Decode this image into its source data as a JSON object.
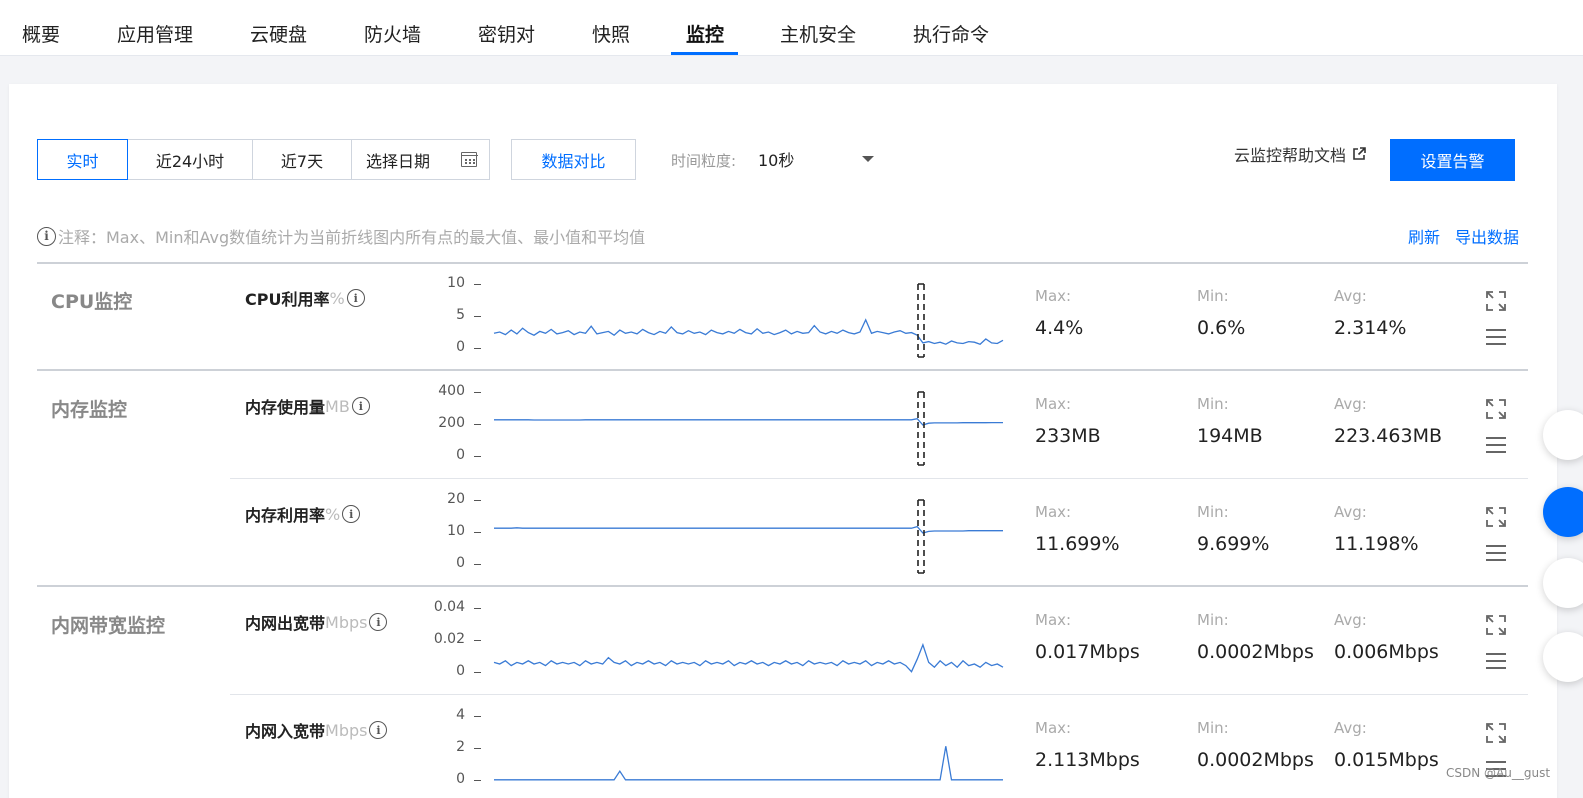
{
  "tabs": [
    {
      "label": "概要",
      "name": "tab-overview",
      "active": false
    },
    {
      "label": "应用管理",
      "name": "tab-app-management",
      "active": false
    },
    {
      "label": "云硬盘",
      "name": "tab-cloud-disk",
      "active": false
    },
    {
      "label": "防火墙",
      "name": "tab-firewall",
      "active": false
    },
    {
      "label": "密钥对",
      "name": "tab-keypair",
      "active": false
    },
    {
      "label": "快照",
      "name": "tab-snapshot",
      "active": false
    },
    {
      "label": "监控",
      "name": "tab-monitoring",
      "active": true
    },
    {
      "label": "主机安全",
      "name": "tab-host-security",
      "active": false
    },
    {
      "label": "执行命令",
      "name": "tab-run-command",
      "active": false
    }
  ],
  "toolbar": {
    "ranges": [
      "实时",
      "近24小时",
      "近7天"
    ],
    "active_range": "实时",
    "date_placeholder": "选择日期",
    "compare_label": "数据对比",
    "granularity_label": "时间粒度:",
    "granularity_value": "10秒",
    "help_label": "云监控帮助文档",
    "alarm_label": "设置告警"
  },
  "note": {
    "text": "注释：Max、Min和Avg数值统计为当前折线图内所有点的最大值、最小值和平均值",
    "refresh_label": "刷新",
    "export_label": "导出数据"
  },
  "stat_labels": {
    "max": "Max:",
    "min": "Min:",
    "avg": "Avg:"
  },
  "groups": [
    {
      "title": "CPU监控"
    },
    {
      "title": "内存监控"
    },
    {
      "title": "内网带宽监控"
    }
  ],
  "chart_data": [
    {
      "type": "line",
      "title": "CPU利用率",
      "unit": "%",
      "yticks": [
        "10",
        "5",
        "0"
      ],
      "ylim": [
        0,
        10
      ],
      "series": [
        {
          "values": [
            2.3,
            2.5,
            2.1,
            2.8,
            2.2,
            3.1,
            2.4,
            2.0,
            2.6,
            2.3,
            2.9,
            2.2,
            2.4,
            2.7,
            2.1,
            2.5,
            2.3,
            3.4,
            2.2,
            2.4,
            2.6,
            2.0,
            2.8,
            2.3,
            2.5,
            2.2,
            2.9,
            2.4,
            2.1,
            2.6,
            2.3,
            3.3,
            2.4,
            2.2,
            2.7,
            2.3,
            2.5,
            2.1,
            2.8,
            2.4,
            2.2,
            2.6,
            2.3,
            2.9,
            2.4,
            2.2,
            3.0,
            2.3,
            2.5,
            2.1,
            2.4,
            2.8,
            2.2,
            2.6,
            2.3,
            2.4,
            3.5,
            2.5,
            2.2,
            2.6,
            2.3,
            2.8,
            2.4,
            2.2,
            2.5,
            4.4,
            2.3,
            2.6,
            2.4,
            2.2,
            2.5,
            2.7,
            2.3,
            2.4,
            2.0,
            0.8,
            1.0,
            0.7,
            0.9,
            0.6,
            1.1,
            0.8,
            0.7,
            1.0,
            0.9,
            0.6,
            1.4,
            0.8,
            0.7,
            1.2
          ]
        }
      ]
    },
    {
      "type": "line",
      "title": "内存使用量",
      "unit": "MB",
      "yticks": [
        "400",
        "200",
        "0"
      ],
      "ylim": [
        0,
        400
      ],
      "series": [
        {
          "values": [
            226,
            226,
            226,
            226,
            226,
            226,
            226,
            225,
            225,
            225,
            225,
            225,
            225,
            225,
            225,
            225,
            226,
            226,
            226,
            226,
            226,
            226,
            226,
            226,
            226,
            226,
            226,
            226,
            226,
            226,
            226,
            226,
            226,
            226,
            226,
            226,
            226,
            226,
            226,
            226,
            226,
            226,
            226,
            226,
            226,
            226,
            226,
            226,
            226,
            226,
            226,
            226,
            226,
            226,
            226,
            226,
            226,
            226,
            226,
            226,
            226,
            226,
            226,
            226,
            226,
            226,
            226,
            226,
            226,
            226,
            226,
            226,
            226,
            226,
            233,
            194,
            205,
            207,
            207,
            207,
            207,
            207,
            208,
            208,
            208,
            208,
            208,
            209,
            209,
            209
          ]
        }
      ]
    },
    {
      "type": "line",
      "title": "内存利用率",
      "unit": "%",
      "yticks": [
        "20",
        "10",
        "0"
      ],
      "ylim": [
        0,
        20
      ],
      "series": [
        {
          "values": [
            11.2,
            11.2,
            11.2,
            11.2,
            11.3,
            11.2,
            11.2,
            11.2,
            11.2,
            11.2,
            11.2,
            11.2,
            11.2,
            11.2,
            11.2,
            11.2,
            11.2,
            11.2,
            11.2,
            11.2,
            11.2,
            11.2,
            11.2,
            11.2,
            11.2,
            11.2,
            11.2,
            11.2,
            11.2,
            11.2,
            11.2,
            11.2,
            11.2,
            11.2,
            11.2,
            11.2,
            11.2,
            11.2,
            11.2,
            11.2,
            11.2,
            11.2,
            11.2,
            11.2,
            11.2,
            11.2,
            11.2,
            11.2,
            11.2,
            11.2,
            11.2,
            11.2,
            11.2,
            11.2,
            11.2,
            11.2,
            11.2,
            11.2,
            11.2,
            11.2,
            11.2,
            11.2,
            11.2,
            11.2,
            11.2,
            11.2,
            11.2,
            11.2,
            11.2,
            11.2,
            11.2,
            11.2,
            11.2,
            11.2,
            11.7,
            9.7,
            10.2,
            10.3,
            10.3,
            10.3,
            10.3,
            10.3,
            10.3,
            10.4,
            10.4,
            10.4,
            10.4,
            10.4,
            10.4,
            10.4
          ]
        }
      ]
    },
    {
      "type": "line",
      "title": "内网出宽带",
      "unit": "Mbps",
      "yticks": [
        "0.04",
        "0.02",
        "0"
      ],
      "ylim": [
        0,
        0.04
      ],
      "series": [
        {
          "values": [
            0.006,
            0.005,
            0.007,
            0.004,
            0.006,
            0.005,
            0.007,
            0.005,
            0.006,
            0.004,
            0.007,
            0.005,
            0.006,
            0.005,
            0.006,
            0.004,
            0.007,
            0.005,
            0.006,
            0.005,
            0.009,
            0.006,
            0.005,
            0.007,
            0.004,
            0.006,
            0.005,
            0.007,
            0.005,
            0.006,
            0.004,
            0.007,
            0.005,
            0.006,
            0.005,
            0.006,
            0.004,
            0.007,
            0.005,
            0.006,
            0.005,
            0.007,
            0.004,
            0.006,
            0.005,
            0.007,
            0.005,
            0.006,
            0.004,
            0.006,
            0.005,
            0.007,
            0.005,
            0.006,
            0.004,
            0.007,
            0.005,
            0.006,
            0.005,
            0.006,
            0.004,
            0.007,
            0.005,
            0.006,
            0.005,
            0.007,
            0.004,
            0.006,
            0.005,
            0.007,
            0.005,
            0.006,
            0.004,
            0.0002,
            0.008,
            0.017,
            0.006,
            0.003,
            0.007,
            0.004,
            0.006,
            0.003,
            0.007,
            0.004,
            0.005,
            0.003,
            0.006,
            0.004,
            0.005,
            0.003
          ]
        }
      ]
    },
    {
      "type": "line",
      "title": "内网入宽带",
      "unit": "Mbps",
      "yticks": [
        "4",
        "2",
        "0"
      ],
      "ylim": [
        0,
        4
      ],
      "series": [
        {
          "values": [
            0.01,
            0.01,
            0.01,
            0.01,
            0.01,
            0.01,
            0.01,
            0.01,
            0.01,
            0.01,
            0.01,
            0.01,
            0.01,
            0.01,
            0.01,
            0.01,
            0.01,
            0.01,
            0.01,
            0.01,
            0.01,
            0.01,
            0.55,
            0.01,
            0.01,
            0.01,
            0.01,
            0.01,
            0.01,
            0.01,
            0.01,
            0.01,
            0.01,
            0.01,
            0.01,
            0.01,
            0.01,
            0.01,
            0.01,
            0.01,
            0.01,
            0.01,
            0.01,
            0.01,
            0.01,
            0.01,
            0.01,
            0.01,
            0.01,
            0.01,
            0.01,
            0.01,
            0.01,
            0.01,
            0.01,
            0.01,
            0.01,
            0.01,
            0.01,
            0.01,
            0.01,
            0.01,
            0.01,
            0.01,
            0.01,
            0.01,
            0.01,
            0.01,
            0.01,
            0.01,
            0.01,
            0.01,
            0.01,
            0.01,
            0.01,
            0.01,
            0.01,
            0.01,
            0.01,
            2.113,
            0.01,
            0.01,
            0.01,
            0.01,
            0.01,
            0.01,
            0.01,
            0.01,
            0.01,
            0.01
          ]
        }
      ]
    }
  ],
  "stats": [
    {
      "max": "4.4%",
      "min": "0.6%",
      "avg": "2.314%"
    },
    {
      "max": "233MB",
      "min": "194MB",
      "avg": "223.463MB"
    },
    {
      "max": "11.699%",
      "min": "9.699%",
      "avg": "11.198%"
    },
    {
      "max": "0.017Mbps",
      "min": "0.0002Mbps",
      "avg": "0.006Mbps"
    },
    {
      "max": "2.113Mbps",
      "min": "0.0002Mbps",
      "avg": "0.015Mbps"
    }
  ],
  "colors": {
    "accent": "#006eff",
    "line": "#3a7bd5"
  },
  "watermark": "CSDN @Au__gust"
}
